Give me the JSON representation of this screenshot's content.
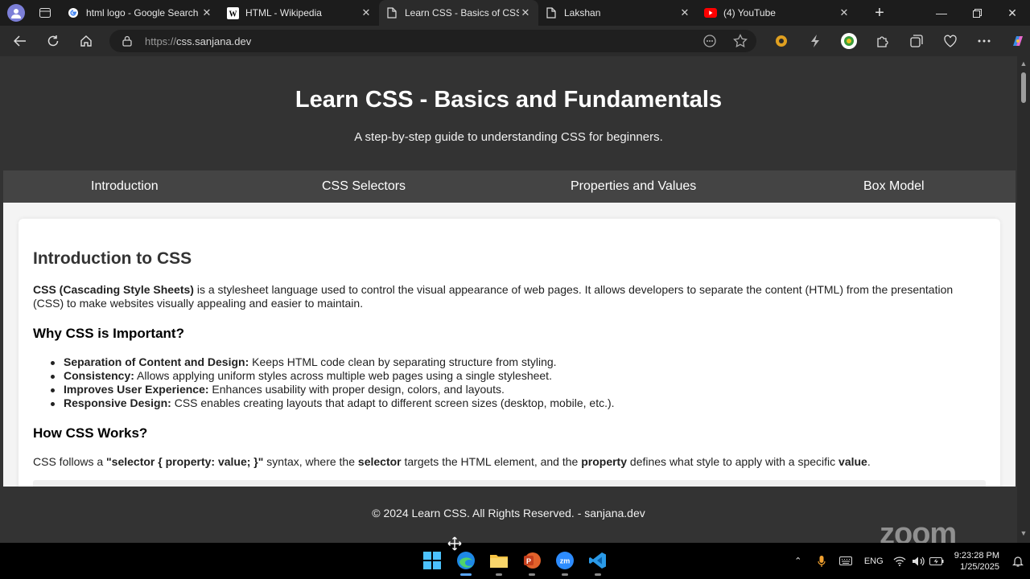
{
  "browser": {
    "tabs": [
      {
        "title": "html logo - Google Search",
        "icon": "google-icon",
        "active": false
      },
      {
        "title": "HTML - Wikipedia",
        "icon": "wikipedia-icon",
        "active": false
      },
      {
        "title": "Learn CSS - Basics of CSS",
        "icon": "page-icon",
        "active": true
      },
      {
        "title": "Lakshan",
        "icon": "page-icon",
        "active": false
      },
      {
        "title": "(4) YouTube",
        "icon": "youtube-icon",
        "active": false
      }
    ],
    "address": {
      "protocol": "https://",
      "host": "css.sanjana.dev"
    }
  },
  "page": {
    "header": {
      "title": "Learn CSS - Basics and Fundamentals",
      "subtitle": "A step-by-step guide to understanding CSS for beginners."
    },
    "nav": [
      "Introduction",
      "CSS Selectors",
      "Properties and Values",
      "Box Model"
    ],
    "section": {
      "heading": "Introduction to CSS",
      "intro_bold": "CSS (Cascading Style Sheets)",
      "intro_text": " is a stylesheet language used to control the visual appearance of web pages. It allows developers to separate the content (HTML) from the presentation (CSS) to make websites visually appealing and easier to maintain.",
      "why_heading": "Why CSS is Important?",
      "why_items": [
        {
          "bold": "Separation of Content and Design:",
          "text": " Keeps HTML code clean by separating structure from styling."
        },
        {
          "bold": "Consistency:",
          "text": " Allows applying uniform styles across multiple web pages using a single stylesheet."
        },
        {
          "bold": "Improves User Experience:",
          "text": " Enhances usability with proper design, colors, and layouts."
        },
        {
          "bold": "Responsive Design:",
          "text": " CSS enables creating layouts that adapt to different screen sizes (desktop, mobile, etc.)."
        }
      ],
      "how_heading": "How CSS Works?",
      "how_p1": "CSS follows a ",
      "how_b1": "\"selector { property: value; }\"",
      "how_p2": " syntax, where the ",
      "how_b2": "selector",
      "how_p3": " targets the HTML element, and the ",
      "how_b3": "property",
      "how_p4": " defines what style to apply with a specific ",
      "how_b4": "value",
      "how_p5": "."
    },
    "footer": "© 2024 Learn CSS. All Rights Reserved. - sanjana.dev"
  },
  "overlay": {
    "zoom_watermark": "zoom"
  },
  "taskbar": {
    "language": "ENG",
    "time": "9:23:28 PM",
    "date": "1/25/2025"
  },
  "colors": {
    "page_bg": "#333333",
    "nav_bg": "#444444",
    "card_bg": "#ffffff",
    "accent_blue": "#5aa7ff"
  }
}
